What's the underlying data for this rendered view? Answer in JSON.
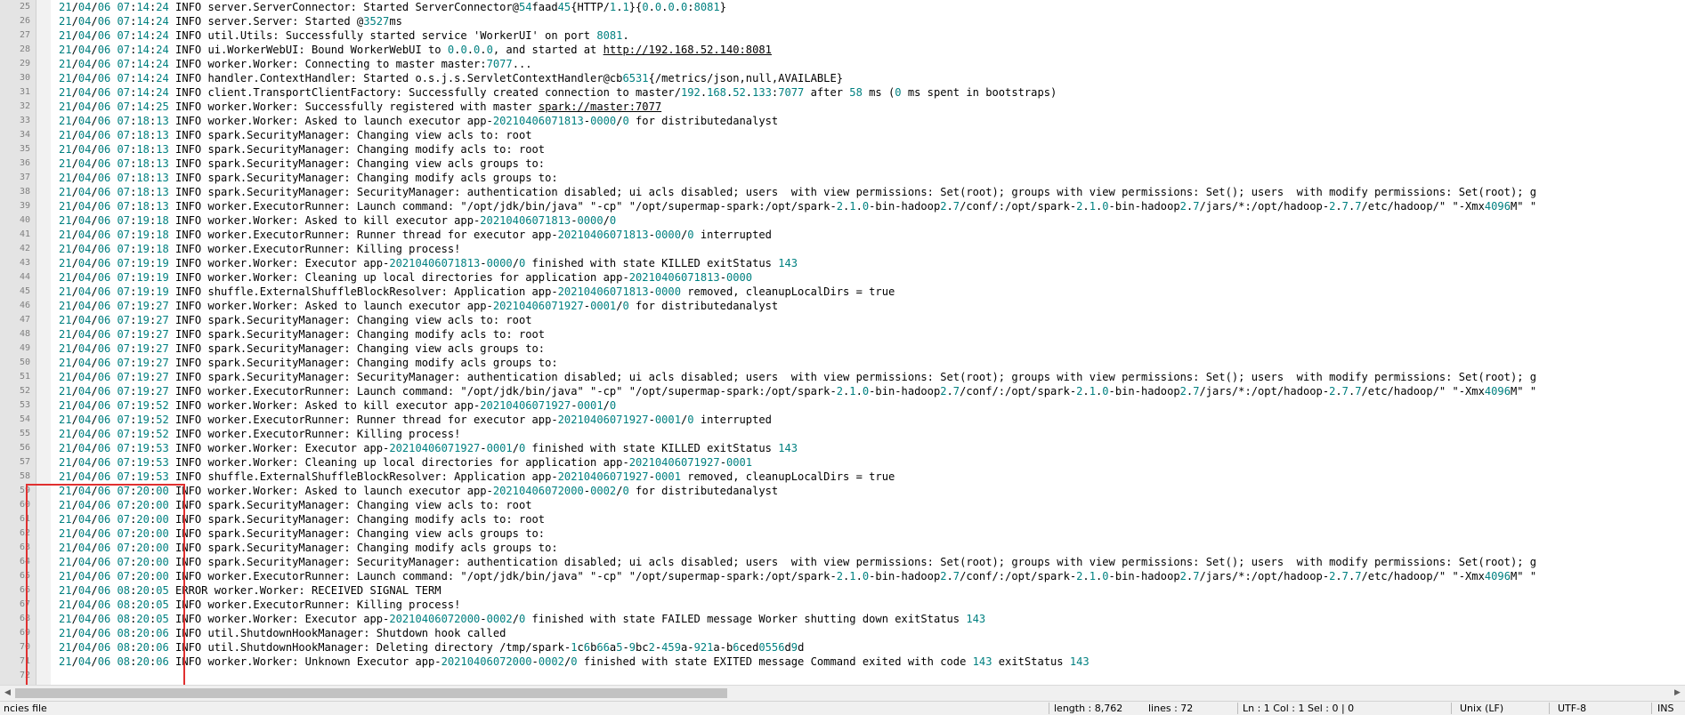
{
  "editor": {
    "lines": [
      {
        "n": "25",
        "text": "21/04/06 07:14:24 INFO server.ServerConnector: Started ServerConnector@54faad45{HTTP/1.1}{0.0.0.0:8081}"
      },
      {
        "n": "26",
        "text": "21/04/06 07:14:24 INFO server.Server: Started @3527ms"
      },
      {
        "n": "27",
        "text": "21/04/06 07:14:24 INFO util.Utils: Successfully started service 'WorkerUI' on port 8081."
      },
      {
        "n": "28",
        "text": "21/04/06 07:14:24 INFO ui.WorkerWebUI: Bound WorkerWebUI to 0.0.0.0, and started at http://192.168.52.140:8081"
      },
      {
        "n": "29",
        "text": "21/04/06 07:14:24 INFO worker.Worker: Connecting to master master:7077..."
      },
      {
        "n": "30",
        "text": "21/04/06 07:14:24 INFO handler.ContextHandler: Started o.s.j.s.ServletContextHandler@cb6531{/metrics/json,null,AVAILABLE}"
      },
      {
        "n": "31",
        "text": "21/04/06 07:14:24 INFO client.TransportClientFactory: Successfully created connection to master/192.168.52.133:7077 after 58 ms (0 ms spent in bootstraps)"
      },
      {
        "n": "32",
        "text": "21/04/06 07:14:25 INFO worker.Worker: Successfully registered with master spark://master:7077"
      },
      {
        "n": "33",
        "text": "21/04/06 07:18:13 INFO worker.Worker: Asked to launch executor app-20210406071813-0000/0 for distributedanalyst"
      },
      {
        "n": "34",
        "text": "21/04/06 07:18:13 INFO spark.SecurityManager: Changing view acls to: root"
      },
      {
        "n": "35",
        "text": "21/04/06 07:18:13 INFO spark.SecurityManager: Changing modify acls to: root"
      },
      {
        "n": "36",
        "text": "21/04/06 07:18:13 INFO spark.SecurityManager: Changing view acls groups to:"
      },
      {
        "n": "37",
        "text": "21/04/06 07:18:13 INFO spark.SecurityManager: Changing modify acls groups to:"
      },
      {
        "n": "38",
        "text": "21/04/06 07:18:13 INFO spark.SecurityManager: SecurityManager: authentication disabled; ui acls disabled; users  with view permissions: Set(root); groups with view permissions: Set(); users  with modify permissions: Set(root); g"
      },
      {
        "n": "39",
        "text": "21/04/06 07:18:13 INFO worker.ExecutorRunner: Launch command: \"/opt/jdk/bin/java\" \"-cp\" \"/opt/supermap-spark:/opt/spark-2.1.0-bin-hadoop2.7/conf/:/opt/spark-2.1.0-bin-hadoop2.7/jars/*:/opt/hadoop-2.7.7/etc/hadoop/\" \"-Xmx4096M\" \""
      },
      {
        "n": "40",
        "text": "21/04/06 07:19:18 INFO worker.Worker: Asked to kill executor app-20210406071813-0000/0"
      },
      {
        "n": "41",
        "text": "21/04/06 07:19:18 INFO worker.ExecutorRunner: Runner thread for executor app-20210406071813-0000/0 interrupted"
      },
      {
        "n": "42",
        "text": "21/04/06 07:19:18 INFO worker.ExecutorRunner: Killing process!"
      },
      {
        "n": "43",
        "text": "21/04/06 07:19:19 INFO worker.Worker: Executor app-20210406071813-0000/0 finished with state KILLED exitStatus 143"
      },
      {
        "n": "44",
        "text": "21/04/06 07:19:19 INFO worker.Worker: Cleaning up local directories for application app-20210406071813-0000"
      },
      {
        "n": "45",
        "text": "21/04/06 07:19:19 INFO shuffle.ExternalShuffleBlockResolver: Application app-20210406071813-0000 removed, cleanupLocalDirs = true"
      },
      {
        "n": "46",
        "text": "21/04/06 07:19:27 INFO worker.Worker: Asked to launch executor app-20210406071927-0001/0 for distributedanalyst"
      },
      {
        "n": "47",
        "text": "21/04/06 07:19:27 INFO spark.SecurityManager: Changing view acls to: root"
      },
      {
        "n": "48",
        "text": "21/04/06 07:19:27 INFO spark.SecurityManager: Changing modify acls to: root"
      },
      {
        "n": "49",
        "text": "21/04/06 07:19:27 INFO spark.SecurityManager: Changing view acls groups to:"
      },
      {
        "n": "50",
        "text": "21/04/06 07:19:27 INFO spark.SecurityManager: Changing modify acls groups to:"
      },
      {
        "n": "51",
        "text": "21/04/06 07:19:27 INFO spark.SecurityManager: SecurityManager: authentication disabled; ui acls disabled; users  with view permissions: Set(root); groups with view permissions: Set(); users  with modify permissions: Set(root); g"
      },
      {
        "n": "52",
        "text": "21/04/06 07:19:27 INFO worker.ExecutorRunner: Launch command: \"/opt/jdk/bin/java\" \"-cp\" \"/opt/supermap-spark:/opt/spark-2.1.0-bin-hadoop2.7/conf/:/opt/spark-2.1.0-bin-hadoop2.7/jars/*:/opt/hadoop-2.7.7/etc/hadoop/\" \"-Xmx4096M\" \""
      },
      {
        "n": "53",
        "text": "21/04/06 07:19:52 INFO worker.Worker: Asked to kill executor app-20210406071927-0001/0"
      },
      {
        "n": "54",
        "text": "21/04/06 07:19:52 INFO worker.ExecutorRunner: Runner thread for executor app-20210406071927-0001/0 interrupted"
      },
      {
        "n": "55",
        "text": "21/04/06 07:19:52 INFO worker.ExecutorRunner: Killing process!"
      },
      {
        "n": "56",
        "text": "21/04/06 07:19:53 INFO worker.Worker: Executor app-20210406071927-0001/0 finished with state KILLED exitStatus 143"
      },
      {
        "n": "57",
        "text": "21/04/06 07:19:53 INFO worker.Worker: Cleaning up local directories for application app-20210406071927-0001"
      },
      {
        "n": "58",
        "text": "21/04/06 07:19:53 INFO shuffle.ExternalShuffleBlockResolver: Application app-20210406071927-0001 removed, cleanupLocalDirs = true"
      },
      {
        "n": "59",
        "text": "21/04/06 07:20:00 INFO worker.Worker: Asked to launch executor app-20210406072000-0002/0 for distributedanalyst"
      },
      {
        "n": "60",
        "text": "21/04/06 07:20:00 INFO spark.SecurityManager: Changing view acls to: root"
      },
      {
        "n": "61",
        "text": "21/04/06 07:20:00 INFO spark.SecurityManager: Changing modify acls to: root"
      },
      {
        "n": "62",
        "text": "21/04/06 07:20:00 INFO spark.SecurityManager: Changing view acls groups to:"
      },
      {
        "n": "63",
        "text": "21/04/06 07:20:00 INFO spark.SecurityManager: Changing modify acls groups to:"
      },
      {
        "n": "64",
        "text": "21/04/06 07:20:00 INFO spark.SecurityManager: SecurityManager: authentication disabled; ui acls disabled; users  with view permissions: Set(root); groups with view permissions: Set(); users  with modify permissions: Set(root); g"
      },
      {
        "n": "65",
        "text": "21/04/06 07:20:00 INFO worker.ExecutorRunner: Launch command: \"/opt/jdk/bin/java\" \"-cp\" \"/opt/supermap-spark:/opt/spark-2.1.0-bin-hadoop2.7/conf/:/opt/spark-2.1.0-bin-hadoop2.7/jars/*:/opt/hadoop-2.7.7/etc/hadoop/\" \"-Xmx4096M\" \""
      },
      {
        "n": "66",
        "text": "21/04/06 08:20:05 ERROR worker.Worker: RECEIVED SIGNAL TERM"
      },
      {
        "n": "67",
        "text": "21/04/06 08:20:05 INFO worker.ExecutorRunner: Killing process!"
      },
      {
        "n": "68",
        "text": "21/04/06 08:20:05 INFO worker.Worker: Executor app-20210406072000-0002/0 finished with state FAILED message Worker shutting down exitStatus 143"
      },
      {
        "n": "69",
        "text": "21/04/06 08:20:06 INFO util.ShutdownHookManager: Shutdown hook called"
      },
      {
        "n": "70",
        "text": "21/04/06 08:20:06 INFO util.ShutdownHookManager: Deleting directory /tmp/spark-1c6b66a5-9bc2-459a-921a-b6ced0556d9d"
      },
      {
        "n": "71",
        "text": "21/04/06 08:20:06 INFO worker.Worker: Unknown Executor app-20210406072000-0002/0 finished with state EXITED message Command exited with code 143 exitStatus 143"
      },
      {
        "n": "72",
        "text": ""
      }
    ]
  },
  "scrollbar": {
    "left_arrow": "◀",
    "right_arrow": "▶"
  },
  "statusbar": {
    "file_type": "ncies file",
    "length": "length : 8,762",
    "lines": "lines : 72",
    "position": "Ln : 1    Col : 1    Sel : 0 | 0",
    "eol": "Unix (LF)",
    "encoding": "UTF-8",
    "mode": "INS"
  },
  "colors": {
    "number": "#008080",
    "highlight_box": "#e03030",
    "gutter": "#e4e4e4"
  }
}
